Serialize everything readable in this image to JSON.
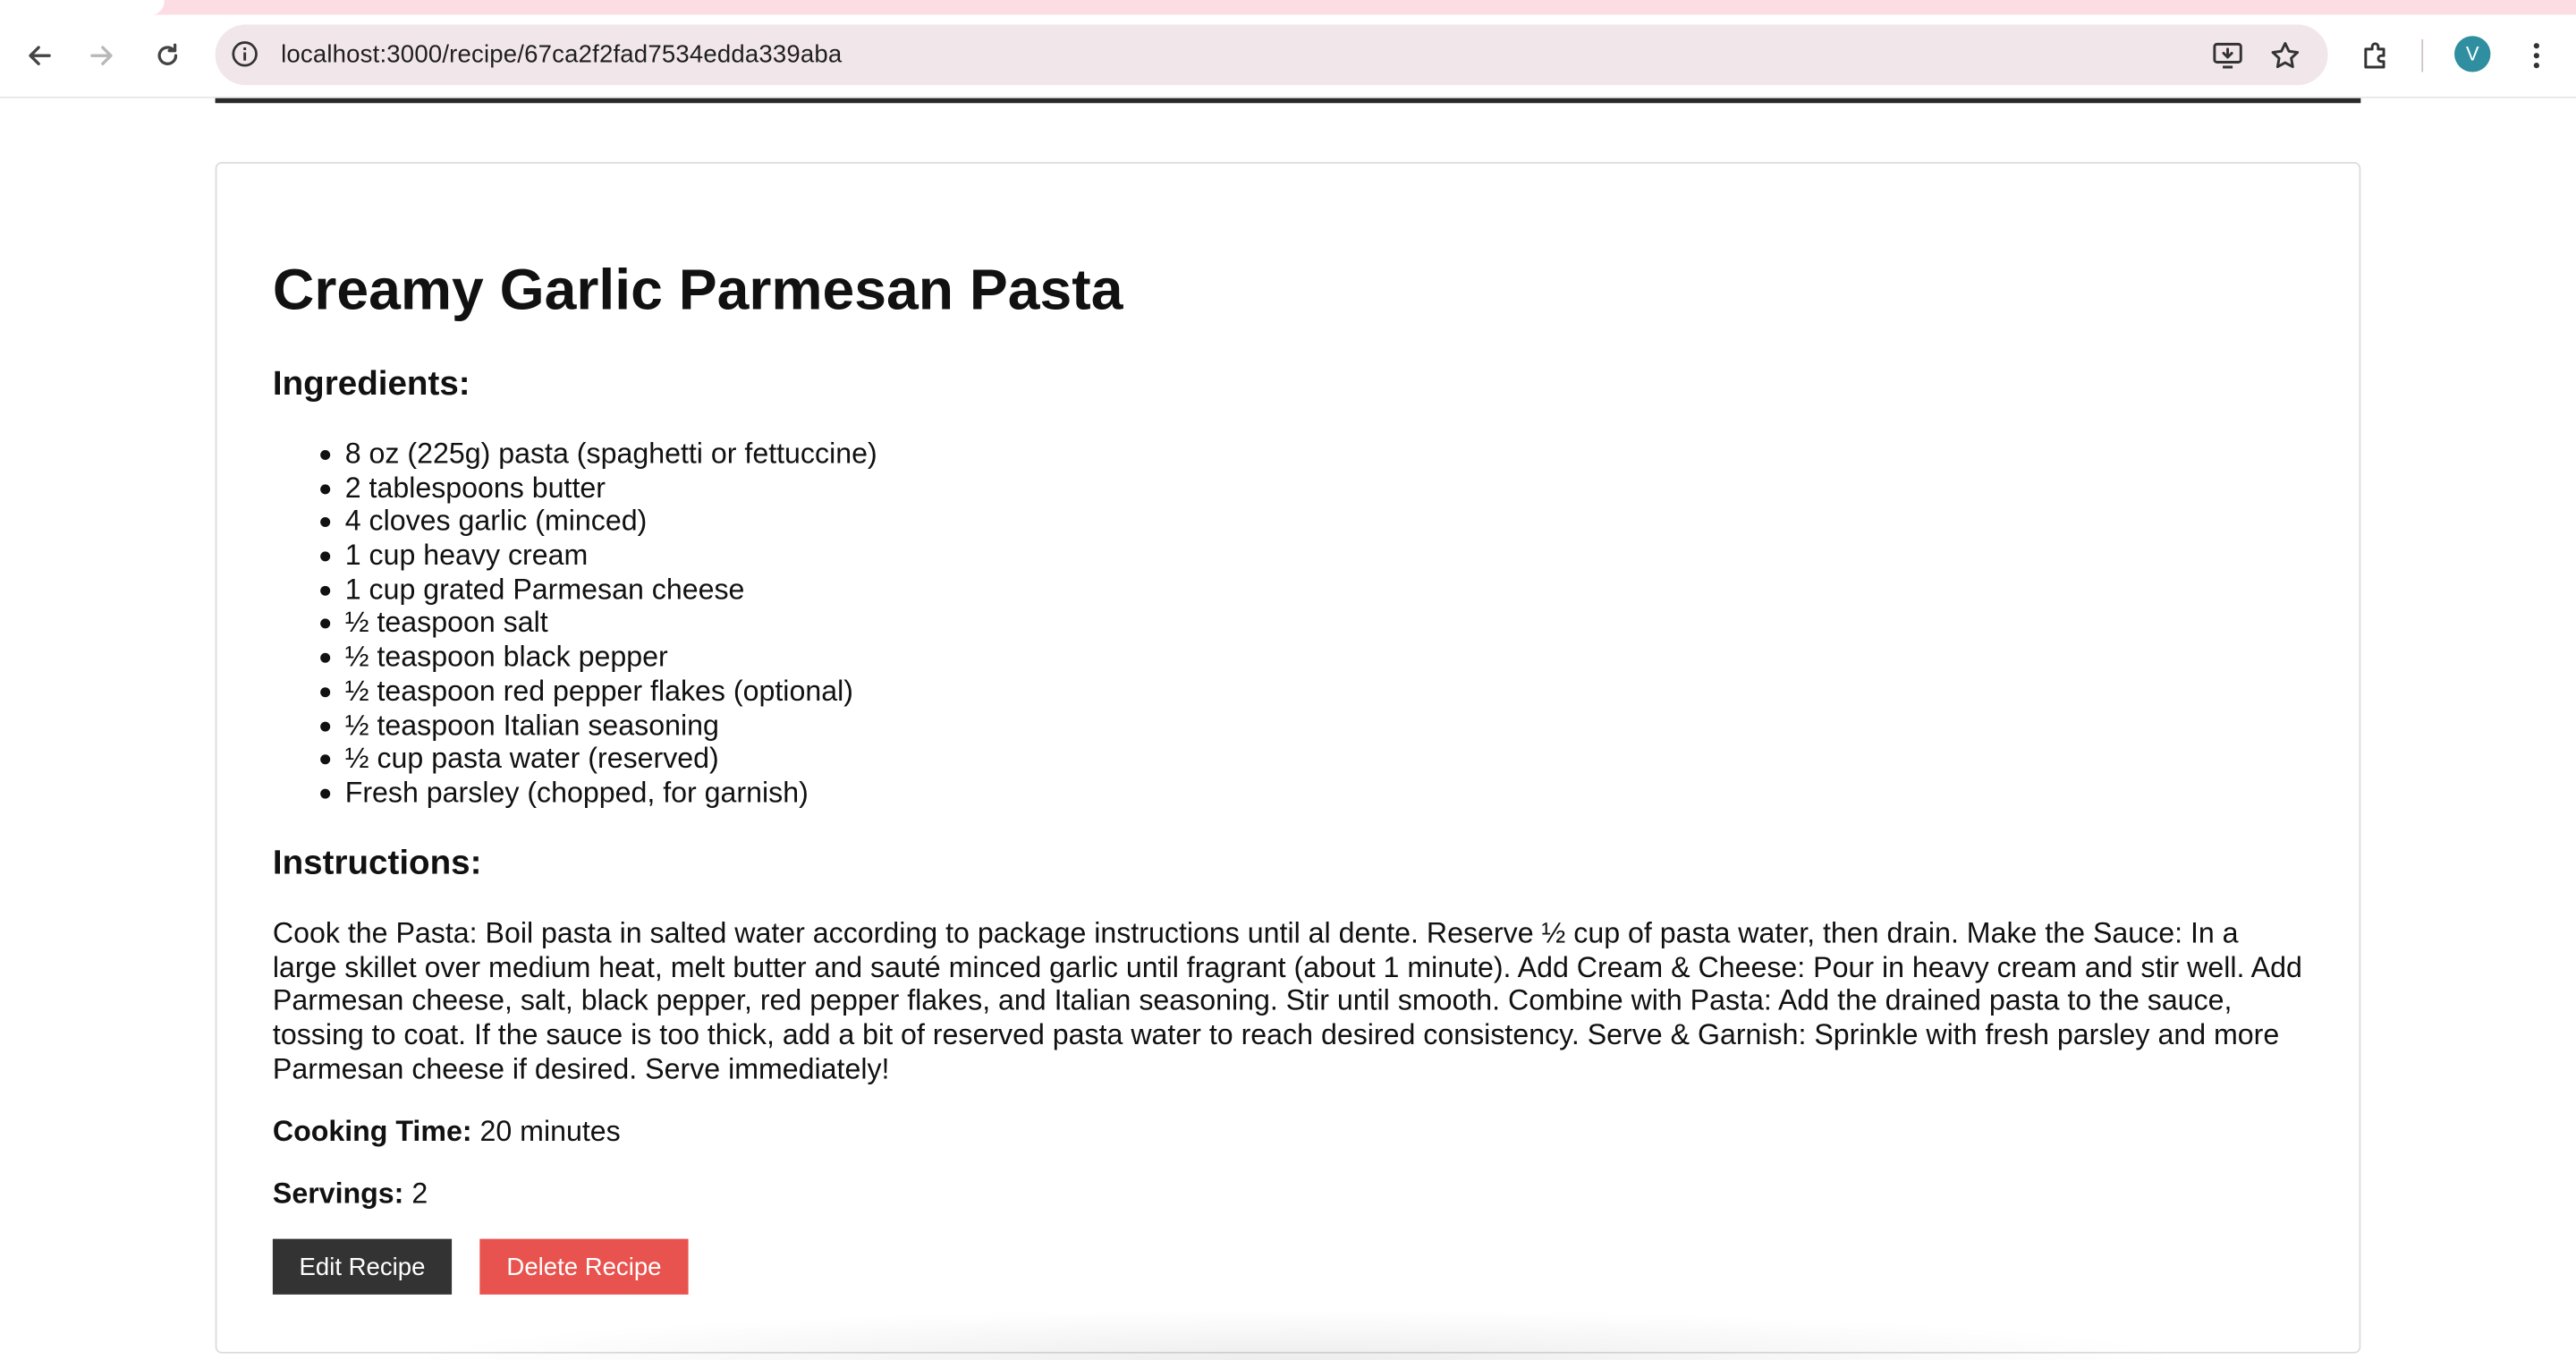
{
  "browser": {
    "url": "localhost:3000/recipe/67ca2f2fad7534edda339aba",
    "profile_initial": "V",
    "colors": {
      "tab_strip": "#fbdde3",
      "omnibox": "#f1e6ea",
      "avatar": "#2f8ea0"
    }
  },
  "recipe": {
    "title": "Creamy Garlic Parmesan Pasta",
    "ingredients_heading": "Ingredients:",
    "ingredients": [
      "8 oz (225g) pasta (spaghetti or fettuccine)",
      "2 tablespoons butter",
      "4 cloves garlic (minced)",
      "1 cup heavy cream",
      "1 cup grated Parmesan cheese",
      "½ teaspoon salt",
      "½ teaspoon black pepper",
      "½ teaspoon red pepper flakes (optional)",
      "½ teaspoon Italian seasoning",
      "½ cup pasta water (reserved)",
      "Fresh parsley (chopped, for garnish)"
    ],
    "instructions_heading": "Instructions:",
    "instructions": "Cook the Pasta: Boil pasta in salted water according to package instructions until al dente. Reserve ½ cup of pasta water, then drain. Make the Sauce: In a large skillet over medium heat, melt butter and sauté minced garlic until fragrant (about 1 minute). Add Cream & Cheese: Pour in heavy cream and stir well. Add Parmesan cheese, salt, black pepper, red pepper flakes, and Italian seasoning. Stir until smooth. Combine with Pasta: Add the drained pasta to the sauce, tossing to coat. If the sauce is too thick, add a bit of reserved pasta water to reach desired consistency. Serve & Garnish: Sprinkle with fresh parsley and more Parmesan cheese if desired. Serve immediately!",
    "cooking_time_label": "Cooking Time:",
    "cooking_time_value": "20 minutes",
    "servings_label": "Servings:",
    "servings_value": "2"
  },
  "actions": {
    "edit_label": "Edit Recipe",
    "delete_label": "Delete Recipe",
    "colors": {
      "edit": "#333333",
      "delete": "#e8534f"
    }
  }
}
